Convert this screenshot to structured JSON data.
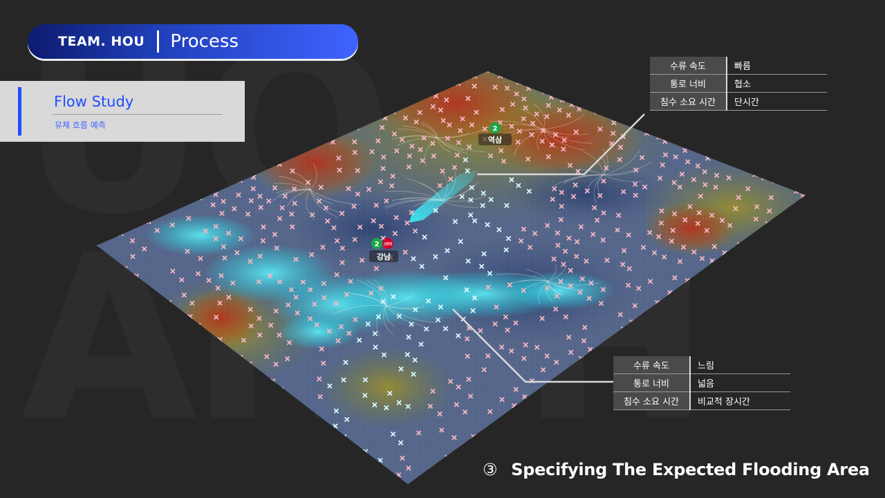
{
  "header": {
    "team": "TEAM. HOU",
    "section": "Process"
  },
  "side": {
    "title": "Flow Study",
    "subtitle": "유체 흐름 예측"
  },
  "stations": [
    {
      "line": "2",
      "name": "역삼"
    },
    {
      "line": "2",
      "name": "강남",
      "badge": "신분당"
    }
  ],
  "table_top": [
    {
      "key": "수류 속도",
      "value": "빠름"
    },
    {
      "key": "통로 너비",
      "value": "협소"
    },
    {
      "key": "침수 소요 시간",
      "value": "단시간"
    }
  ],
  "table_bottom": [
    {
      "key": "수류 속도",
      "value": "느림"
    },
    {
      "key": "통로 너비",
      "value": "넓음"
    },
    {
      "key": "침수 소요 시간",
      "value": "비교적 장시간"
    }
  ],
  "caption": {
    "number": "③",
    "text": "Specifying The Expected Flooding Area"
  },
  "colors": {
    "accent": "#1f4cff",
    "flow": "#39e6f0",
    "marker": "#f6b8c4",
    "line2": "#1aa64a",
    "sinbundang": "#d4002a"
  }
}
